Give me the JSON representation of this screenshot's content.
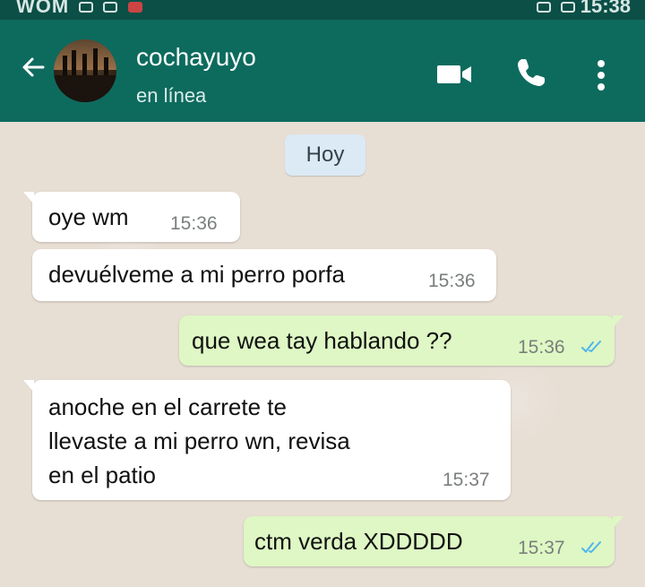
{
  "status_bar": {
    "carrier": "WOM",
    "clock": "15:38"
  },
  "header": {
    "contact_name": "cochayuyo",
    "contact_status": "en línea"
  },
  "chat": {
    "date_chip": "Hoy",
    "messages": [
      {
        "direction": "in",
        "text": "oye wm",
        "time": "15:36"
      },
      {
        "direction": "in",
        "text": "devuélveme a mi perro porfa",
        "time": "15:36"
      },
      {
        "direction": "out",
        "text": "que wea tay hablando ??",
        "time": "15:36",
        "read": true
      },
      {
        "direction": "in",
        "lines": [
          "anoche en el carrete te",
          "llevaste a mi perro wn, revisa",
          "en el patio"
        ],
        "time": "15:37"
      },
      {
        "direction": "out",
        "text": "ctm verda XDDDDD",
        "time": "15:37",
        "read": true
      }
    ]
  },
  "colors": {
    "header_bg": "#0d6b5e",
    "incoming_bubble": "#ffffff",
    "outgoing_bubble": "#def7c4",
    "read_ticks": "#4fb6ec"
  },
  "icons": [
    "back-arrow-icon",
    "video-call-icon",
    "phone-call-icon",
    "more-options-icon",
    "double-check-icon"
  ]
}
